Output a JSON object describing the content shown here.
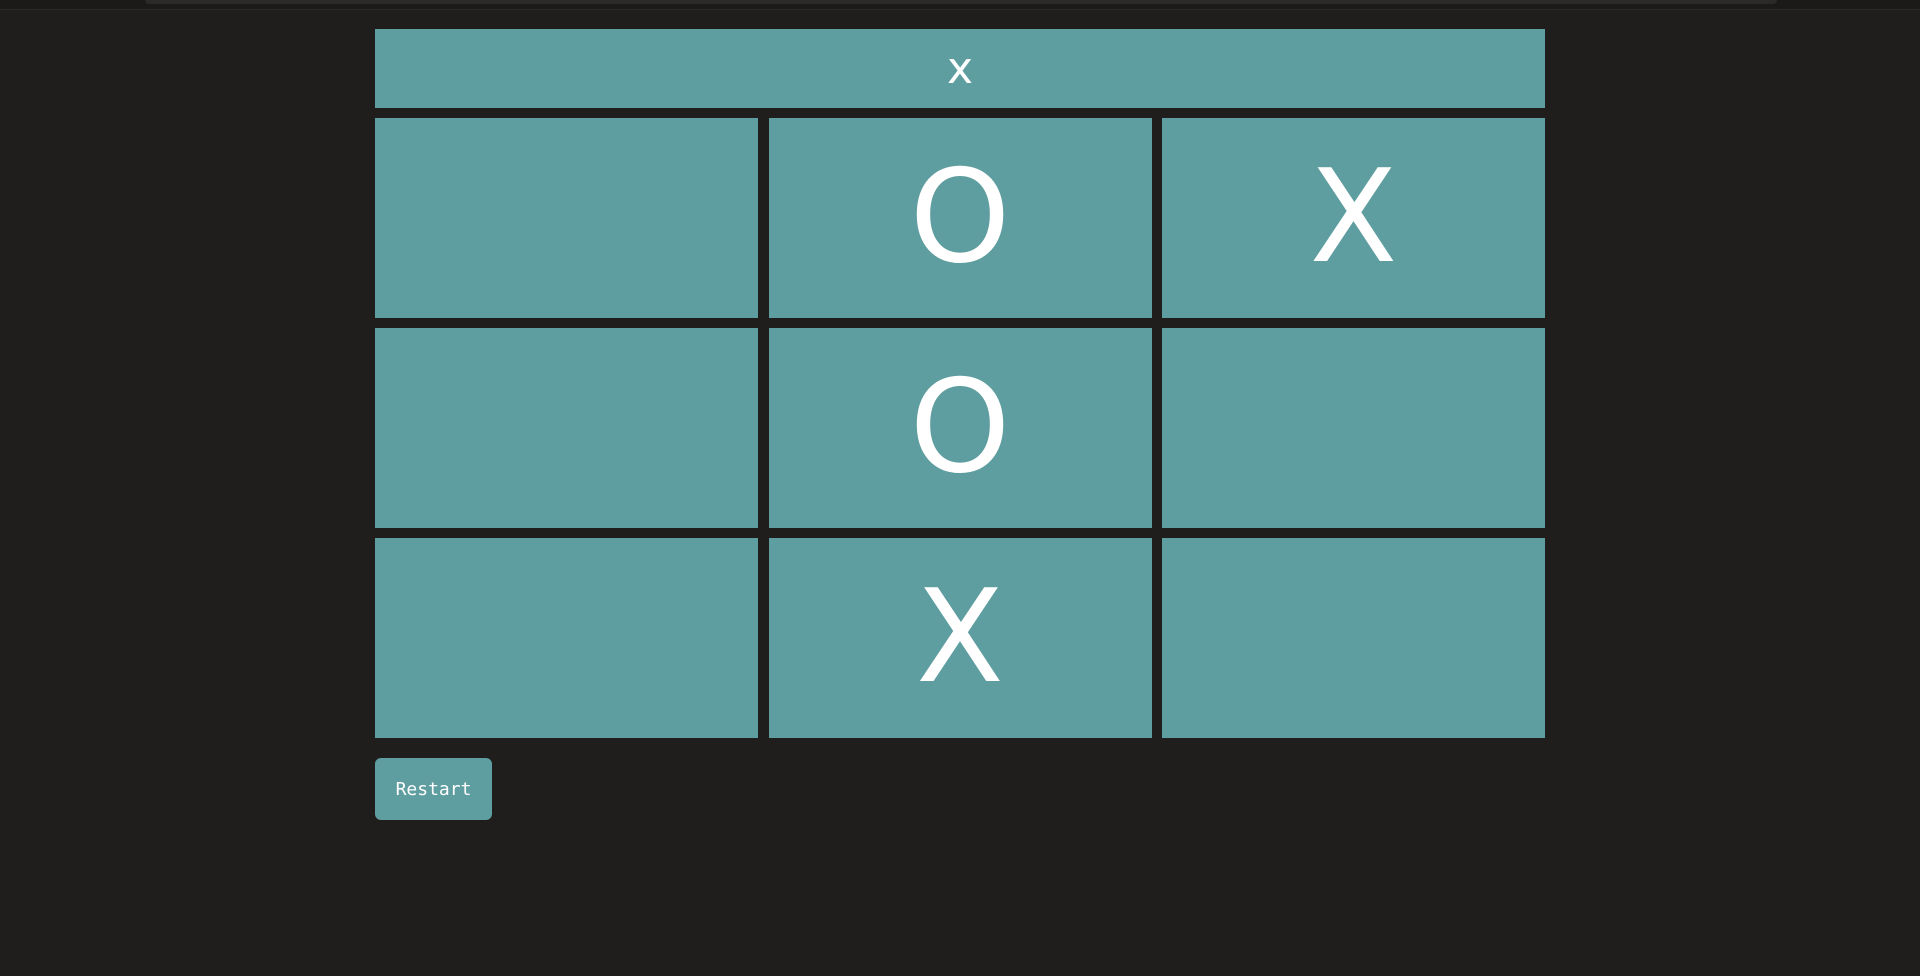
{
  "game": {
    "turn_label": "x",
    "cells": [
      "",
      "O",
      "X",
      "",
      "O",
      "",
      "",
      "X",
      ""
    ],
    "restart_label": "Restart"
  },
  "colors": {
    "background": "#201e1d",
    "tile": "#5f9ea0",
    "text": "#ffffff"
  }
}
